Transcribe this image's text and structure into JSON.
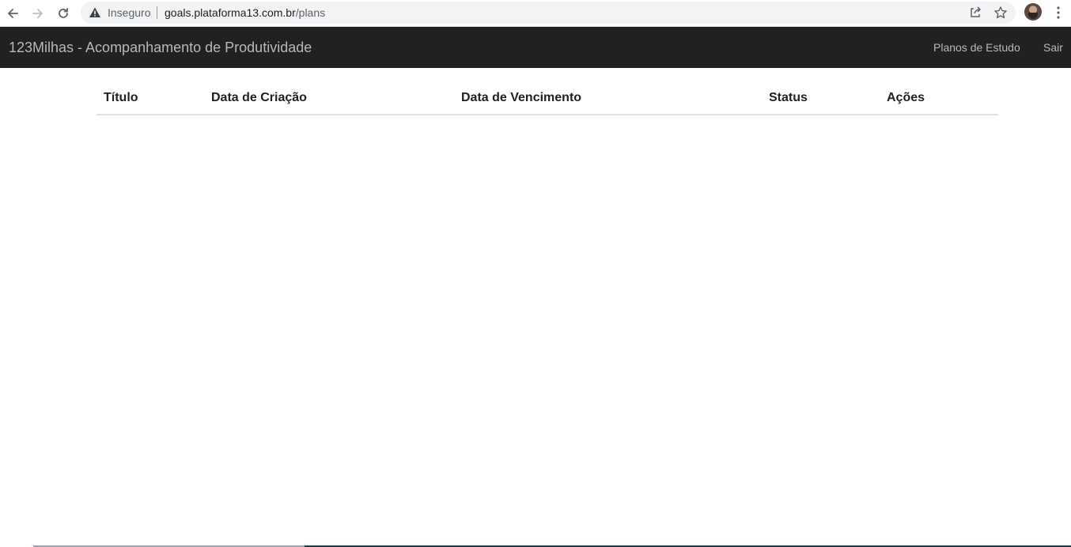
{
  "browser": {
    "security_label": "Inseguro",
    "url_host": "goals.plataforma13.com.br",
    "url_path": "/plans",
    "icons": [
      "back-arrow-icon",
      "forward-arrow-icon",
      "reload-icon",
      "warning-icon",
      "share-icon",
      "star-icon",
      "kebab-menu-icon"
    ]
  },
  "navbar": {
    "brand": "123Milhas - Acompanhamento de Produtividade",
    "links": {
      "plans": "Planos de Estudo",
      "logout": "Sair"
    },
    "background_color": "#212121",
    "text_color": "#b8b8b8"
  },
  "table": {
    "columns": [
      "Título",
      "Data de Criação",
      "Data de Vencimento",
      "Status",
      "Ações"
    ],
    "rows": []
  }
}
